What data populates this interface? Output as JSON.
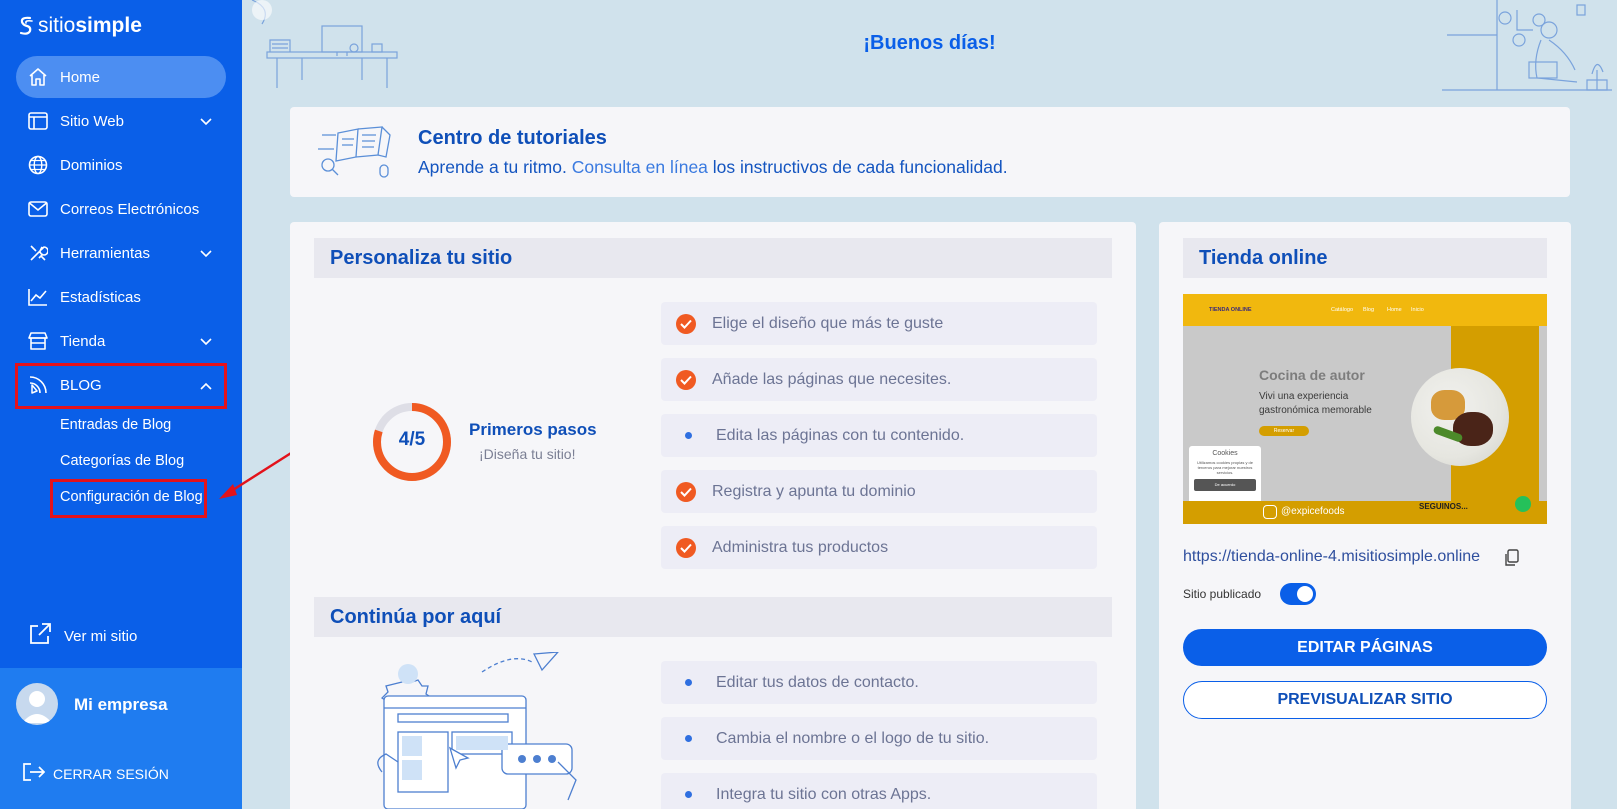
{
  "brand": {
    "prefix": "sitio",
    "bold": "simple"
  },
  "sidebar": {
    "items": [
      {
        "label": "Home"
      },
      {
        "label": "Sitio Web"
      },
      {
        "label": "Dominios"
      },
      {
        "label": "Correos Electrónicos"
      },
      {
        "label": "Herramientas"
      },
      {
        "label": "Estadísticas"
      },
      {
        "label": "Tienda"
      },
      {
        "label": "BLOG"
      }
    ],
    "blog_sub": [
      "Entradas de Blog",
      "Categorías de Blog",
      "Configuración de Blog"
    ],
    "view_site": "Ver mi sitio",
    "company": "Mi empresa",
    "logout": "CERRAR SESIÓN"
  },
  "header": {
    "greeting": "¡Buenos días!"
  },
  "tutorials": {
    "title": "Centro de tutoriales",
    "text_before": "Aprende a tu ritmo.",
    "link": "Consulta en línea",
    "text_after": "los instructivos de cada funcionalidad."
  },
  "personalize": {
    "title": "Personaliza tu sitio",
    "progress_text": "4/5",
    "progress_fraction": 0.8,
    "steps_title": "Primeros pasos",
    "steps_subtitle": "¡Diseña tu sitio!",
    "steps": [
      {
        "label": "Elige el diseño que más te guste",
        "done": true
      },
      {
        "label": "Añade las páginas que necesites.",
        "done": true
      },
      {
        "label": "Edita las páginas con tu contenido.",
        "done": false
      },
      {
        "label": "Registra y apunta tu dominio",
        "done": true
      },
      {
        "label": "Administra tus productos",
        "done": true
      }
    ]
  },
  "continue": {
    "title": "Continúa por aquí",
    "items": [
      "Editar tus datos de contacto.",
      "Cambia el nombre o el logo de tu sitio.",
      "Integra tu sitio con otras Apps."
    ]
  },
  "store": {
    "title": "Tienda online",
    "url": "https://tienda-online-4.misitiosimple.online",
    "published_label": "Sitio publicado",
    "published": true,
    "edit_button": "EDITAR PÁGINAS",
    "preview_button": "PREVISUALIZAR SITIO",
    "preview": {
      "brand": "TIENDA ONLINE",
      "nav": [
        "Catálogo",
        "Blog",
        "Home",
        "Inicio"
      ],
      "headline": "Cocina de autor",
      "subline": "Vivi una experiencia gastronómica memorable",
      "button": "Reservar",
      "cookie_title": "Cookies",
      "cookie_text": "Utilizamos cookies propias y de terceros para mejorar nuestros servicios.",
      "cookie_button": "De acuerdo",
      "handle": "@expicefoods",
      "follow": "SEGUINOS..."
    }
  },
  "colors": {
    "accent": "#0a5fe8",
    "check": "#f05a22",
    "highlight": "#e3121b"
  }
}
